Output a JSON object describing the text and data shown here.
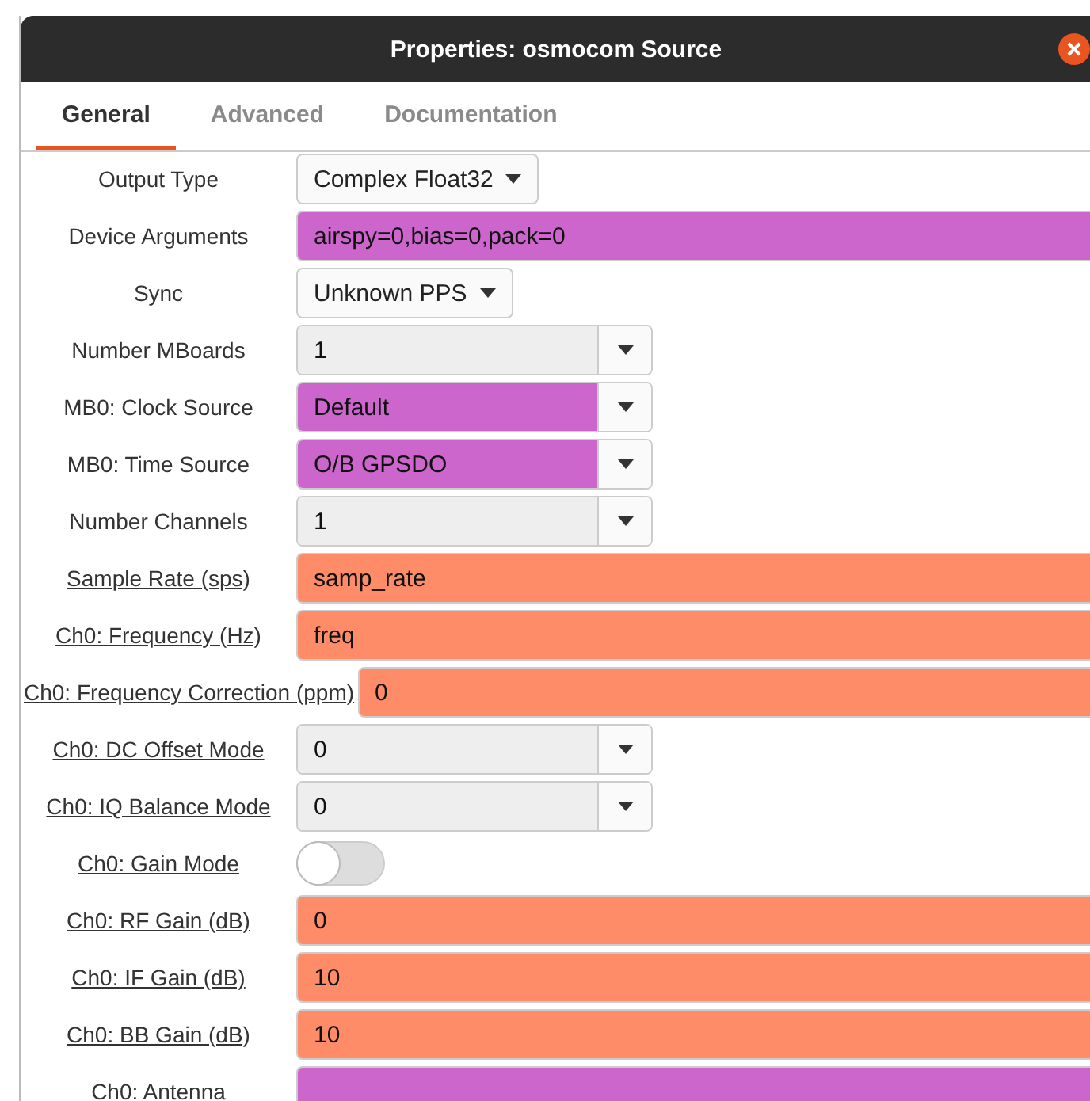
{
  "window": {
    "title": "Properties: osmocom Source"
  },
  "tabs": [
    {
      "label": "General",
      "selected": true
    },
    {
      "label": "Advanced",
      "selected": false
    },
    {
      "label": "Documentation",
      "selected": false
    }
  ],
  "rows": [
    {
      "label": "Output Type",
      "underlined": false,
      "kind": "dropdown",
      "value": "Complex Float32"
    },
    {
      "label": "Device Arguments",
      "underlined": false,
      "kind": "entry",
      "value": "airspy=0,bias=0,pack=0",
      "color": "#cc66cc"
    },
    {
      "label": "Sync",
      "underlined": false,
      "kind": "dropdown",
      "value": "Unknown PPS"
    },
    {
      "label": "Number MBoards",
      "underlined": false,
      "kind": "combo",
      "value": "1",
      "color": "#eeeeee"
    },
    {
      "label": "MB0: Clock Source",
      "underlined": false,
      "kind": "combo",
      "value": "Default",
      "color": "#cc66cc"
    },
    {
      "label": "MB0: Time Source",
      "underlined": false,
      "kind": "combo",
      "value": "O/B GPSDO",
      "color": "#cc66cc"
    },
    {
      "label": "Number Channels",
      "underlined": false,
      "kind": "combo",
      "value": "1",
      "color": "#eeeeee"
    },
    {
      "label": "Sample Rate (sps)",
      "underlined": true,
      "kind": "entry",
      "value": "samp_rate",
      "color": "#ff8c69"
    },
    {
      "label": "Ch0: Frequency (Hz)",
      "underlined": true,
      "kind": "entry",
      "value": "freq",
      "color": "#ff8c69"
    },
    {
      "label": "Ch0: Frequency Correction (ppm)",
      "underlined": true,
      "kind": "entry",
      "value": "0",
      "color": "#ff8c69"
    },
    {
      "label": "Ch0: DC Offset Mode",
      "underlined": true,
      "kind": "combo",
      "value": "0",
      "color": "#eeeeee"
    },
    {
      "label": "Ch0: IQ Balance Mode",
      "underlined": true,
      "kind": "combo",
      "value": "0",
      "color": "#eeeeee"
    },
    {
      "label": "Ch0: Gain Mode",
      "underlined": true,
      "kind": "switch",
      "on": false
    },
    {
      "label": "Ch0: RF Gain (dB)",
      "underlined": true,
      "kind": "entry",
      "value": "0",
      "color": "#ff8c69"
    },
    {
      "label": "Ch0: IF Gain (dB)",
      "underlined": true,
      "kind": "entry",
      "value": "10",
      "color": "#ff8c69"
    },
    {
      "label": "Ch0: BB Gain (dB)",
      "underlined": true,
      "kind": "entry",
      "value": "10",
      "color": "#ff8c69"
    },
    {
      "label": "Ch0: Antenna",
      "kind": "entry",
      "color": "#cc66cc"
    }
  ]
}
